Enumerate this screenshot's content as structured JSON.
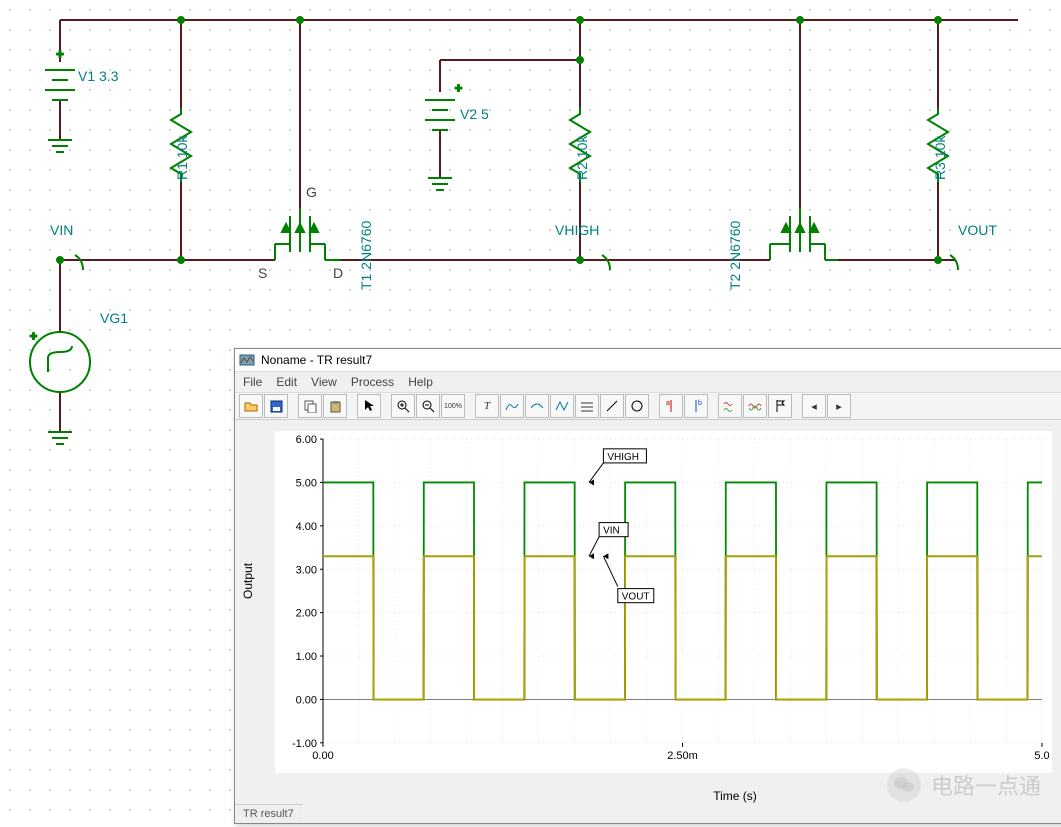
{
  "schematic": {
    "v1": {
      "name": "V1",
      "value": "3.3"
    },
    "v2": {
      "name": "V2",
      "value": "5"
    },
    "r1": {
      "name": "R1",
      "value": "10k"
    },
    "r2": {
      "name": "R2",
      "value": "10k"
    },
    "r3": {
      "name": "R3",
      "value": "10k"
    },
    "t1": {
      "name": "T1",
      "model": "2N6760"
    },
    "t2": {
      "name": "T2",
      "model": "2N6760"
    },
    "vg1": "VG1",
    "vin": "VIN",
    "vhigh": "VHIGH",
    "vout": "VOUT",
    "gate": "G",
    "source": "S",
    "drain": "D"
  },
  "window": {
    "title": "Noname - TR result7",
    "menu": {
      "file": "File",
      "edit": "Edit",
      "view": "View",
      "process": "Process",
      "help": "Help"
    },
    "status_tab": "TR result7"
  },
  "plot": {
    "ylabel": "Output",
    "xlabel": "Time (s)",
    "yticks": [
      "-1.00",
      "0.00",
      "1.00",
      "2.00",
      "3.00",
      "4.00",
      "5.00",
      "6.00"
    ],
    "xticks": [
      "0.00",
      "2.50m",
      "5.0"
    ],
    "annotations": {
      "vhigh": "VHIGH",
      "vin": "VIN",
      "vout": "VOUT"
    }
  },
  "watermark": "电路一点通",
  "chart_data": {
    "type": "line",
    "title": "TR result7",
    "xlabel": "Time (s)",
    "ylabel": "Output",
    "ylim": [
      -1.0,
      6.0
    ],
    "xlim": [
      0.0,
      0.005
    ],
    "x": [
      0.0,
      0.00035,
      0.000351,
      0.0007,
      0.000701,
      0.00105,
      0.001051,
      0.0014,
      0.001401,
      0.00175,
      0.001751,
      0.0021,
      0.002101,
      0.00245,
      0.002451,
      0.0028,
      0.002801,
      0.00315,
      0.003151,
      0.0035,
      0.003501,
      0.00385,
      0.003851,
      0.0042,
      0.004201,
      0.00455,
      0.004551,
      0.0049,
      0.004901,
      0.005
    ],
    "series": [
      {
        "name": "VHIGH",
        "color": "#008a00",
        "y": [
          5.0,
          5.0,
          0.0,
          0.0,
          5.0,
          5.0,
          0.0,
          0.0,
          5.0,
          5.0,
          0.0,
          0.0,
          5.0,
          5.0,
          0.0,
          0.0,
          5.0,
          5.0,
          0.0,
          0.0,
          5.0,
          5.0,
          0.0,
          0.0,
          5.0,
          5.0,
          0.0,
          0.0,
          5.0,
          5.0
        ]
      },
      {
        "name": "VIN",
        "color": "#7a0000",
        "y": [
          3.3,
          3.3,
          0.0,
          0.0,
          3.3,
          3.3,
          0.0,
          0.0,
          3.3,
          3.3,
          0.0,
          0.0,
          3.3,
          3.3,
          0.0,
          0.0,
          3.3,
          3.3,
          0.0,
          0.0,
          3.3,
          3.3,
          0.0,
          0.0,
          3.3,
          3.3,
          0.0,
          0.0,
          3.3,
          3.3
        ]
      },
      {
        "name": "VOUT",
        "color": "#a8a800",
        "y": [
          3.3,
          3.3,
          0.0,
          0.0,
          3.3,
          3.3,
          0.0,
          0.0,
          3.3,
          3.3,
          0.0,
          0.0,
          3.3,
          3.3,
          0.0,
          0.0,
          3.3,
          3.3,
          0.0,
          0.0,
          3.3,
          3.3,
          0.0,
          0.0,
          3.3,
          3.3,
          0.0,
          0.0,
          3.3,
          3.3
        ]
      }
    ]
  }
}
